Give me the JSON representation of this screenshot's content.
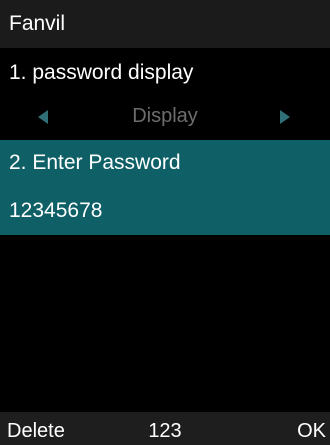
{
  "title_bar": {
    "title": "Fanvil"
  },
  "menu": {
    "item1": {
      "label": "1. password display",
      "selector_value": "Display",
      "left_arrow_icon": "triangle-left-icon",
      "right_arrow_icon": "triangle-right-icon"
    },
    "item2": {
      "label": "2. Enter Password",
      "value": "12345678"
    }
  },
  "softkeys": {
    "left": "Delete",
    "center": "123",
    "right": "OK"
  },
  "colors": {
    "background": "#000000",
    "title_bar": "#1b1b1b",
    "selected_row": "#0e5f66",
    "arrow": "#2f6f75",
    "selector_text": "#6d6d6d",
    "softkey_bar": "#1e1e1e",
    "text": "#ffffff"
  }
}
